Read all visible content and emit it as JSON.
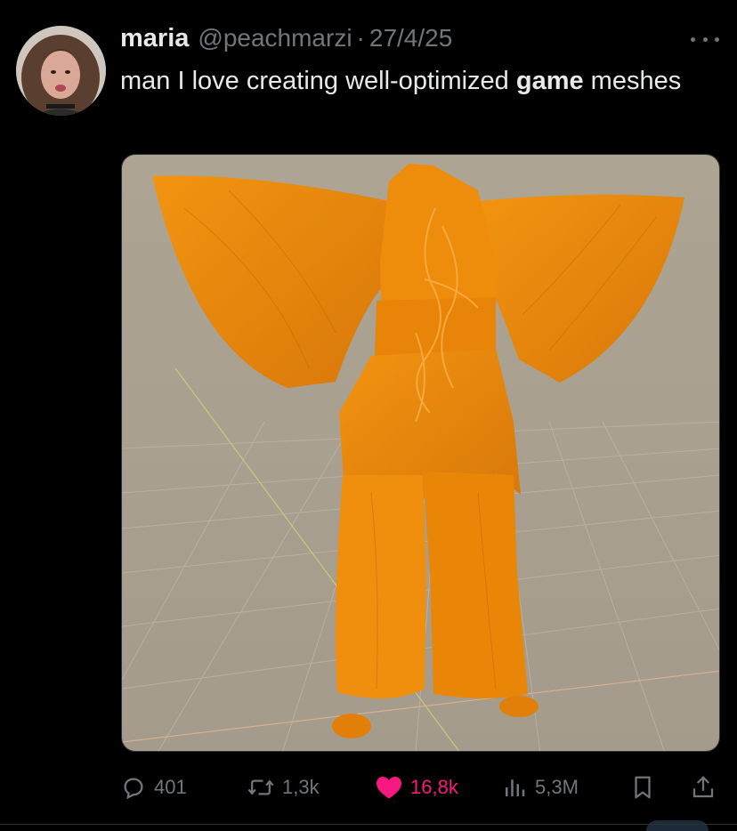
{
  "tweet": {
    "author_name": "maria",
    "author_handle": "@peachmarzi",
    "separator": "·",
    "date": "27/4/25",
    "text_before": "man I love creating well-optimized ",
    "text_bold": "game",
    "text_after": " meshes"
  },
  "media": {
    "description_icon": "3d-garment-mesh-render",
    "background_color": "#a89e90",
    "mesh_color": "#f08c0a"
  },
  "actions": {
    "replies": "401",
    "reposts": "1,3k",
    "likes": "16,8k",
    "views": "5,3M"
  },
  "colors": {
    "background": "#000000",
    "text": "#e7e9ea",
    "secondary": "#71767b",
    "like": "#f91880"
  }
}
